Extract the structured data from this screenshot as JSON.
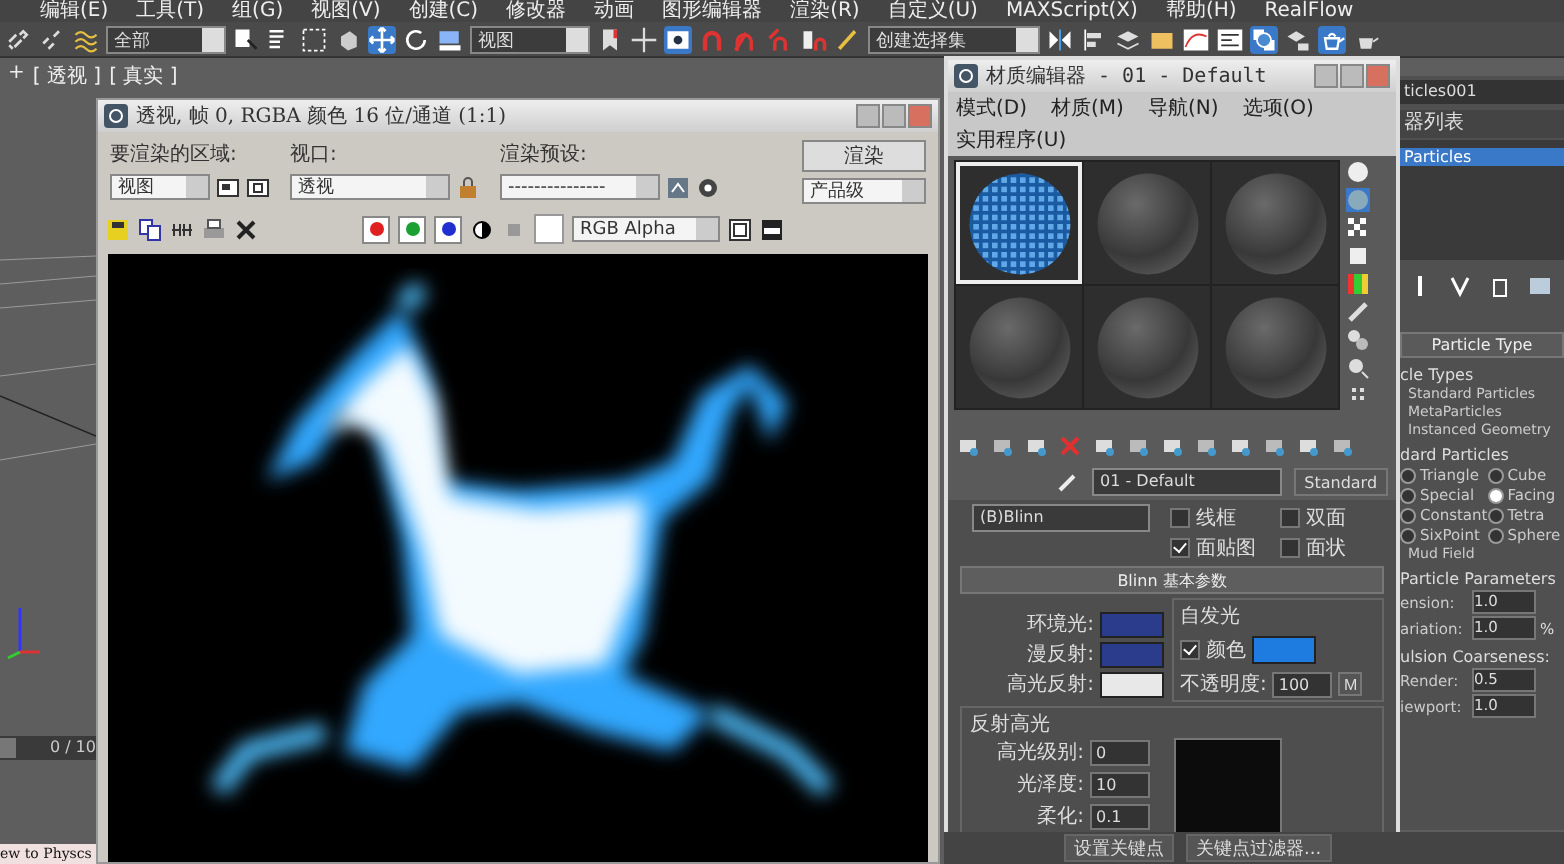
{
  "menu_bar": [
    "编辑(E)",
    "工具(T)",
    "组(G)",
    "视图(V)",
    "创建(C)",
    "修改器",
    "动画",
    "图形编辑器",
    "渲染(R)",
    "自定义(U)",
    "MAXScript(X)",
    "帮助(H)",
    "RealFlow"
  ],
  "main_toolbar": {
    "selection_filter": "全部",
    "reference_coord": "视图",
    "named_selection": "创建选择集"
  },
  "viewport": {
    "labels": [
      "+",
      "[ 透视 ]",
      "[ 真实 ]"
    ],
    "time_slider": {
      "label": "0 / 10",
      "level": 0
    },
    "status_text": "ew to Physcs"
  },
  "render_window": {
    "title": "透视, 帧 0, RGBA 颜色 16 位/通道 (1:1)",
    "area_label": "要渲染的区域:",
    "area_value": "视图",
    "viewport_label": "视口:",
    "viewport_value": "透视",
    "preset_label": "渲染预设:",
    "preset_value": "---------------",
    "render_button": "渲染",
    "quality_value": "产品级",
    "channels": [
      {
        "color": "#e02020",
        "on": true
      },
      {
        "color": "#18a030",
        "on": true
      },
      {
        "color": "#2030d0",
        "on": true
      }
    ],
    "display_value": "RGB Alpha"
  },
  "material_editor": {
    "title": "材质编辑器 - 01 - Default",
    "menus": [
      "模式(D)",
      "材质(M)",
      "导航(N)",
      "选项(O)",
      "实用程序(U)"
    ],
    "slots": [
      {
        "kind": "checker",
        "selected": true
      },
      {
        "kind": "plain",
        "selected": false
      },
      {
        "kind": "plain",
        "selected": false
      },
      {
        "kind": "plain",
        "selected": false
      },
      {
        "kind": "plain",
        "selected": false
      },
      {
        "kind": "plain",
        "selected": false
      }
    ],
    "material_name": "01 - Default",
    "material_type": "Standard",
    "shader": "(B)Blinn",
    "options": [
      {
        "label": "线框",
        "checked": false
      },
      {
        "label": "双面",
        "checked": false
      },
      {
        "label": "面贴图",
        "checked": true
      },
      {
        "label": "面状",
        "checked": false
      }
    ],
    "rollout_title": "Blinn 基本参数",
    "colors": [
      {
        "label": "环境光:",
        "color": "#2c3c8c"
      },
      {
        "label": "漫反射:",
        "color": "#2c3c8c"
      },
      {
        "label": "高光反射:",
        "color": "#e8e8e8"
      }
    ],
    "self_illum": {
      "title": "自发光",
      "label": "颜色",
      "checked": true,
      "color": "#1e7ce0"
    },
    "opacity": {
      "label": "不透明度:",
      "value": "100",
      "map_button": "M"
    },
    "specular": {
      "title": "反射高光",
      "fields": [
        {
          "label": "高光级别:",
          "value": "0"
        },
        {
          "label": "光泽度:",
          "value": "10"
        },
        {
          "label": "柔化:",
          "value": "0.1"
        }
      ]
    }
  },
  "command_panel": {
    "object_name": "ticles001",
    "modifier_list": "器列表",
    "stack": [
      {
        "label": "Particles",
        "selected": true
      }
    ],
    "rollout": "Particle Type",
    "types_title": "cle Types",
    "types": [
      "Standard Particles",
      "MetaParticles",
      "Instanced Geometry"
    ],
    "standard_title": "dard Particles",
    "shapes": [
      {
        "label": "Triangle",
        "selected": false
      },
      {
        "label": "Cube",
        "selected": false
      },
      {
        "label": "Special",
        "selected": false
      },
      {
        "label": "Facing",
        "selected": true
      },
      {
        "label": "Constant",
        "selected": false
      },
      {
        "label": "Tetra",
        "selected": false
      },
      {
        "label": "SixPoint",
        "selected": false
      },
      {
        "label": "Sphere",
        "selected": false
      }
    ],
    "extra": "Mud Field",
    "params_title": "Particle Parameters",
    "params": [
      {
        "label": "ension:",
        "value": "1.0"
      },
      {
        "label": "ariation:",
        "value": "1.0",
        "unit": "%"
      }
    ],
    "coarseness_title": "ulsion Coarseness:",
    "coarseness": [
      {
        "label": "Render:",
        "value": "0.5"
      },
      {
        "label": "iewport:",
        "value": "1.0"
      }
    ]
  },
  "bottom_bar": {
    "set_key": "设置关键点",
    "key_filters": "关键点过滤器..."
  }
}
